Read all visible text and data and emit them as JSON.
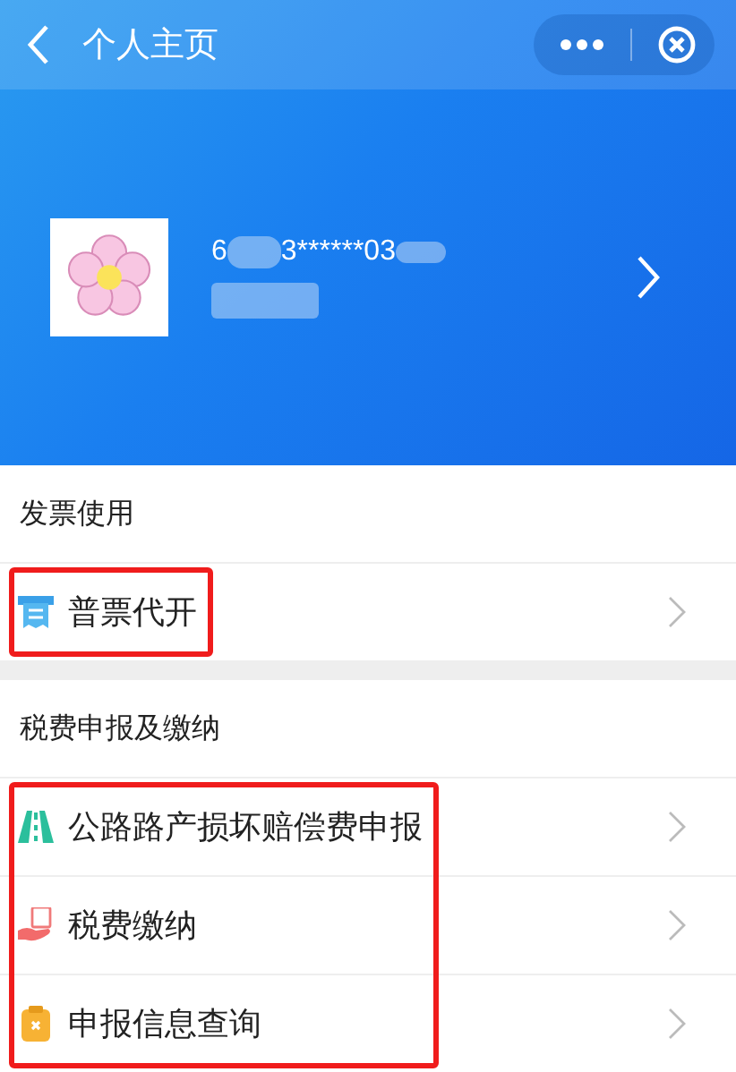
{
  "nav": {
    "title": "个人主页"
  },
  "profile": {
    "id_parts": [
      "6",
      "3******03"
    ]
  },
  "sections": [
    {
      "title": "发票使用",
      "highlighted": true,
      "items": [
        {
          "label": "普票代开",
          "kind": "receipt"
        }
      ]
    },
    {
      "title": "税费申报及缴纳",
      "highlighted": true,
      "items": [
        {
          "label": "公路路产损坏赔偿费申报",
          "kind": "road"
        },
        {
          "label": "税费缴纳",
          "kind": "hand"
        },
        {
          "label": "申报信息查询",
          "kind": "clipboard"
        }
      ]
    }
  ]
}
